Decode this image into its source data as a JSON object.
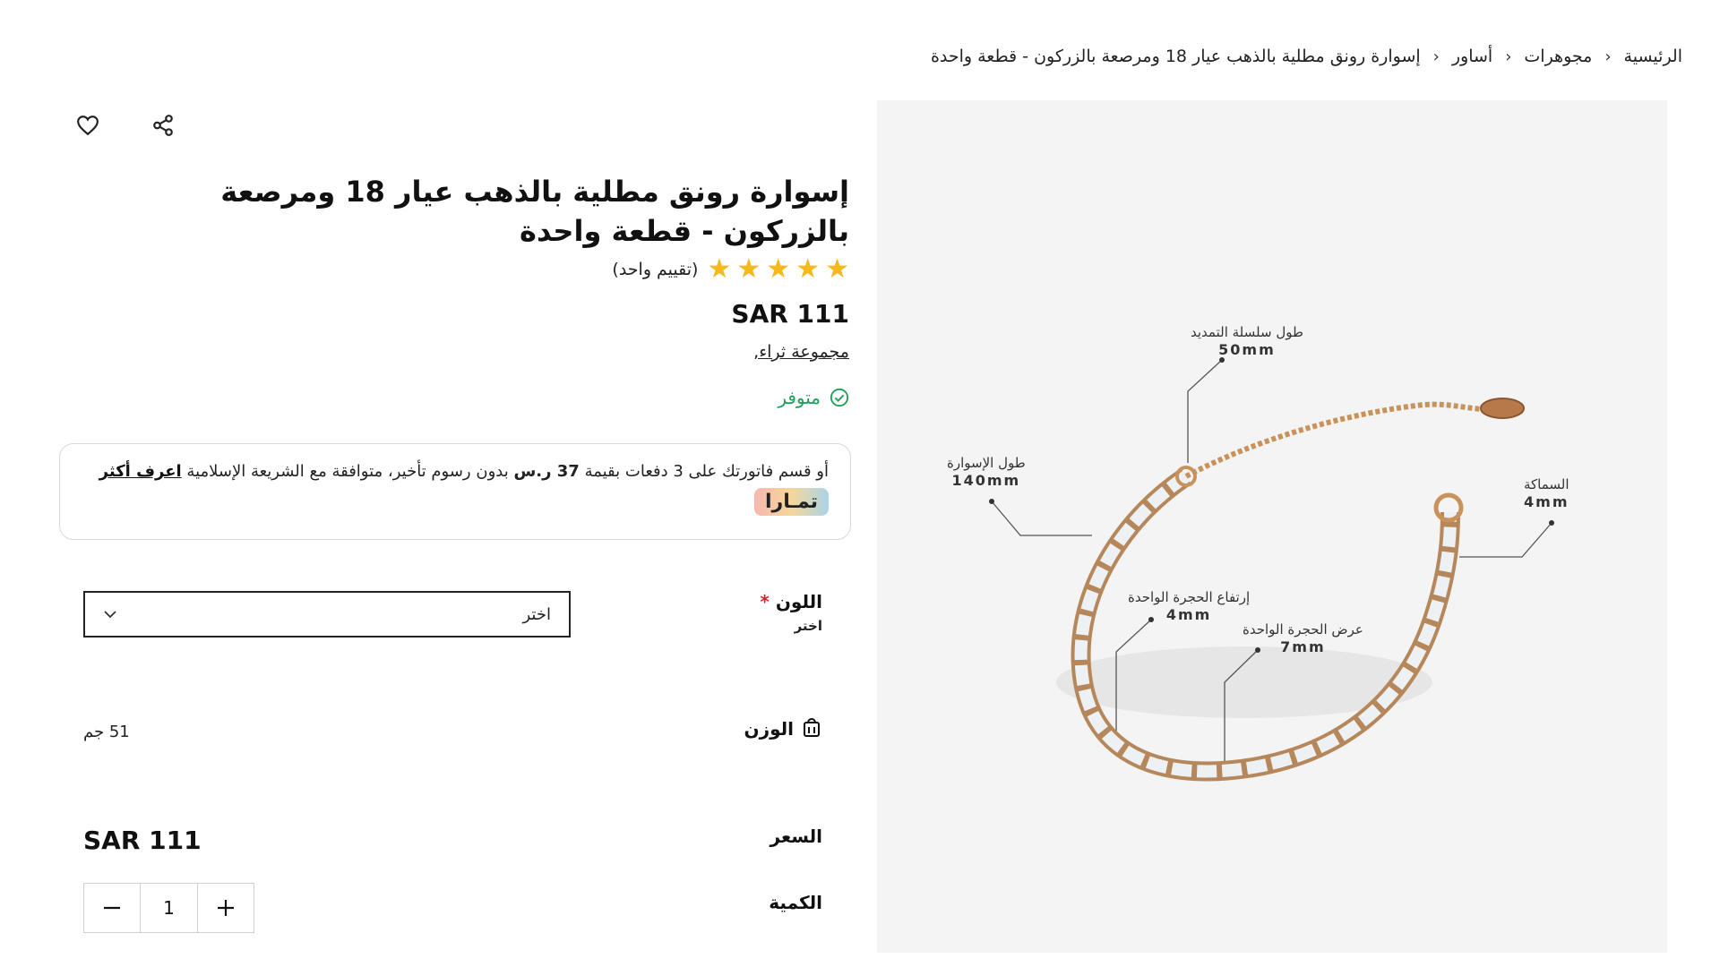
{
  "breadcrumb": {
    "home": "الرئيسية",
    "jewelry": "مجوهرات",
    "bracelets": "أساور",
    "current": "إسوارة رونق مطلية بالذهب عيار 18 ومرصعة بالزركون - قطعة واحدة"
  },
  "product": {
    "title": "إسوارة رونق مطلية بالذهب عيار 18 ومرصعة بالزركون - قطعة واحدة",
    "rating_stars": 5,
    "rating_text": "(تقييم واحد)",
    "price": "SAR 111",
    "collection": "مجموعة ثراء,",
    "stock": "متوفر"
  },
  "tamara": {
    "text_prefix": "أو قسم فاتورتك على 3 دفعات بقيمة",
    "amount": "37 ر.س",
    "text_suffix": "بدون رسوم تأخير، متوافقة مع الشريعة الإسلامية",
    "learn_more": "اعرف أكثر",
    "badge": "تمـارا"
  },
  "options": {
    "color_label": "اللون",
    "required_mark": "*",
    "color_sub": "اختر",
    "color_select_value": "اختر",
    "weight_label": "الوزن",
    "weight_value": "51 جم",
    "price_label": "السعر",
    "price_value": "SAR 111",
    "qty_label": "الكمية",
    "qty_value": "1"
  },
  "image_specs": {
    "extension": {
      "title": "طول سلسلة التمديد",
      "value": "50mm"
    },
    "bracelet_length": {
      "title": "طول الإسوارة",
      "value": "140mm"
    },
    "thickness": {
      "title": "السماكة",
      "value": "4mm"
    },
    "stone_height": {
      "title": "إرتفاع الحجرة الواحدة",
      "value": "4mm"
    },
    "stone_width": {
      "title": "عرض الحجرة الواحدة",
      "value": "7mm"
    }
  },
  "colors": {
    "star": "#f6b81a",
    "stock_green": "#1e9e5a",
    "required_red": "#d4202a"
  }
}
